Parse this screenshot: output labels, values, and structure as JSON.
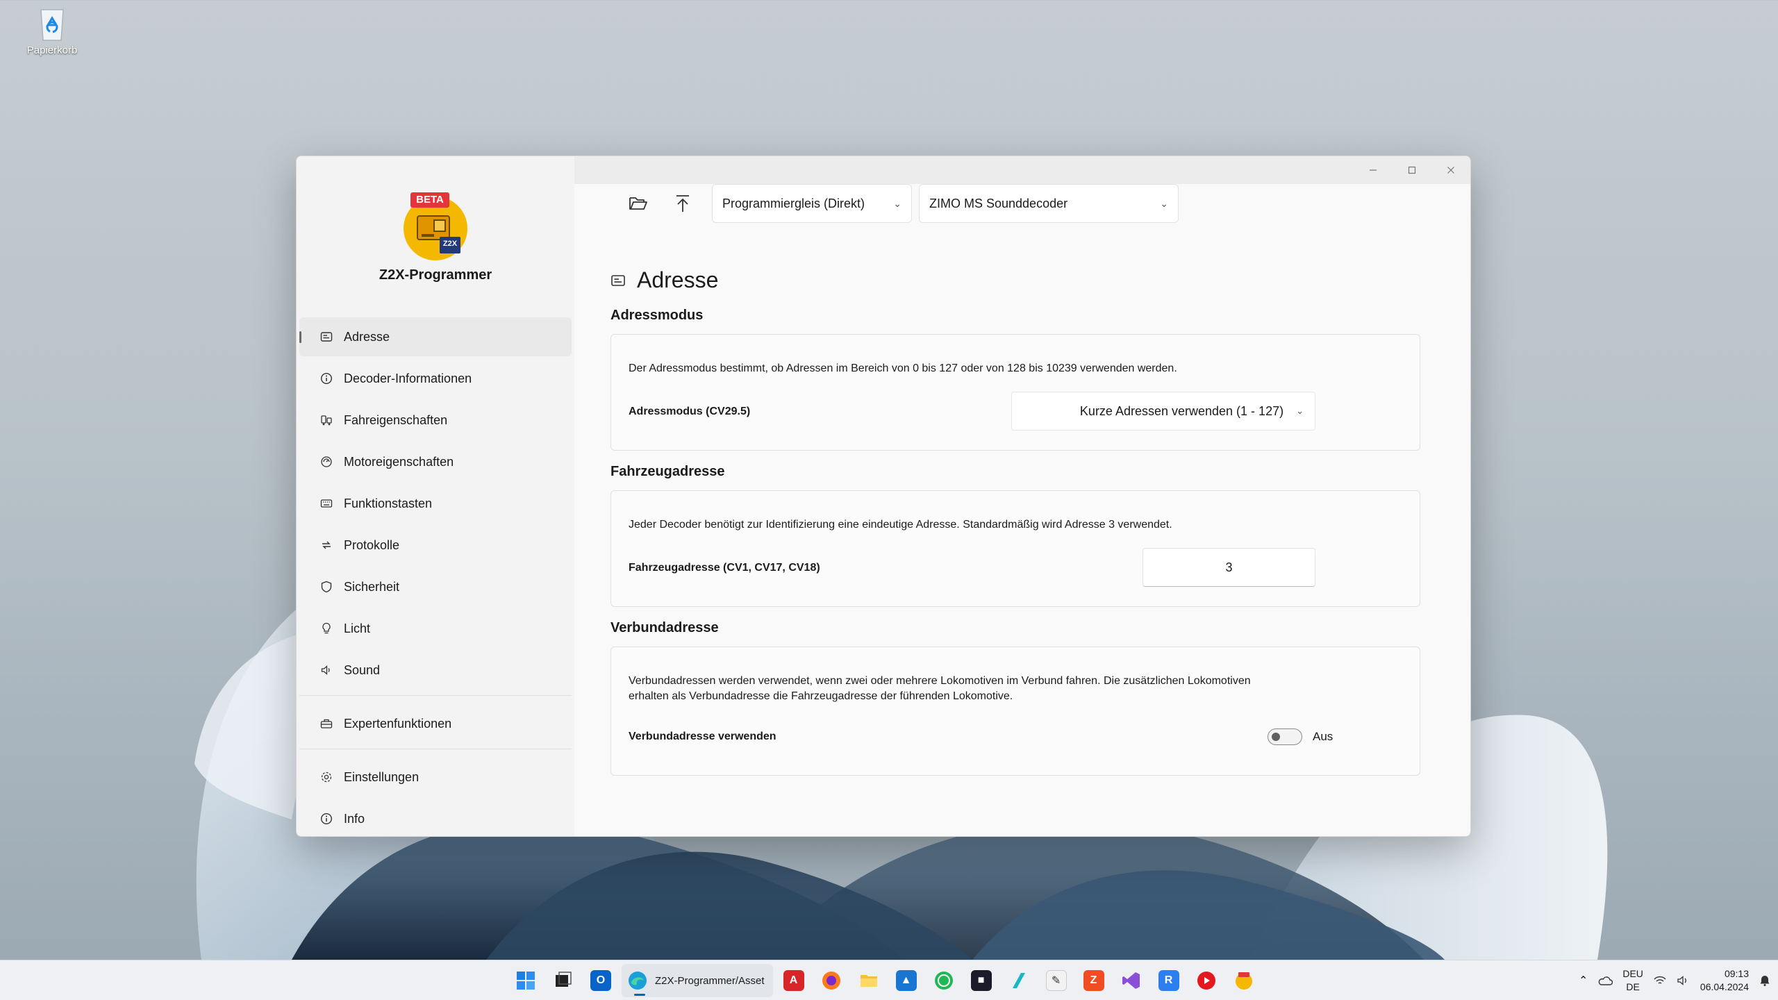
{
  "desktop": {
    "recycle_bin_label": "Papierkorb"
  },
  "app": {
    "name": "Z2X-Programmer",
    "badge": "BETA",
    "logo_text": "Z2X",
    "accent_color": "#f5b800"
  },
  "sidebar": {
    "items": [
      {
        "label": "Adresse",
        "icon": "address-card-icon",
        "active": true
      },
      {
        "label": "Decoder-Informationen",
        "icon": "info-icon"
      },
      {
        "label": "Fahreigenschaften",
        "icon": "driving-icon"
      },
      {
        "label": "Motoreigenschaften",
        "icon": "motor-icon"
      },
      {
        "label": "Funktionstasten",
        "icon": "keyboard-icon"
      },
      {
        "label": "Protokolle",
        "icon": "protocol-icon"
      },
      {
        "label": "Sicherheit",
        "icon": "shield-icon"
      },
      {
        "label": "Licht",
        "icon": "lightbulb-icon"
      },
      {
        "label": "Sound",
        "icon": "speaker-icon"
      }
    ],
    "expert": {
      "label": "Expertenfunktionen",
      "icon": "toolbox-icon"
    },
    "settings": {
      "label": "Einstellungen",
      "icon": "gear-icon"
    },
    "info": {
      "label": "Info",
      "icon": "info-icon"
    }
  },
  "toolbar": {
    "track_mode": "Programmiergleis (Direkt)",
    "decoder": "ZIMO MS Sounddecoder"
  },
  "page": {
    "title": "Adresse",
    "sections": {
      "addressmode": {
        "title": "Adressmodus",
        "description": "Der Adressmodus bestimmt, ob Adressen im Bereich von 0 bis 127 oder von 128 bis 10239 verwenden werden.",
        "label": "Adressmodus (CV29.5)",
        "value": "Kurze Adressen verwenden (1 - 127)"
      },
      "vehicle": {
        "title": "Fahrzeugadresse",
        "description": "Jeder Decoder benötigt zur Identifizierung eine eindeutige Adresse. Standardmäßig wird Adresse 3 verwendet.",
        "label": "Fahrzeugadresse (CV1, CV17, CV18)",
        "value": "3"
      },
      "consist": {
        "title": "Verbundadresse",
        "description_line1": "Verbundadressen werden verwendet, wenn zwei oder mehrere Lokomotiven im Verbund fahren. Die zusätzlichen Lokomotiven",
        "description_line2": "erhalten als Verbundadresse die Fahrzeugadresse der führenden Lokomotive.",
        "label": "Verbundadresse verwenden",
        "toggle_state": "Aus",
        "toggle_on": false
      }
    }
  },
  "taskbar": {
    "active_app_label": "Z2X-Programmer/Asset",
    "language_line1": "DEU",
    "language_line2": "DE",
    "time": "09:13",
    "date": "06.04.2024"
  }
}
